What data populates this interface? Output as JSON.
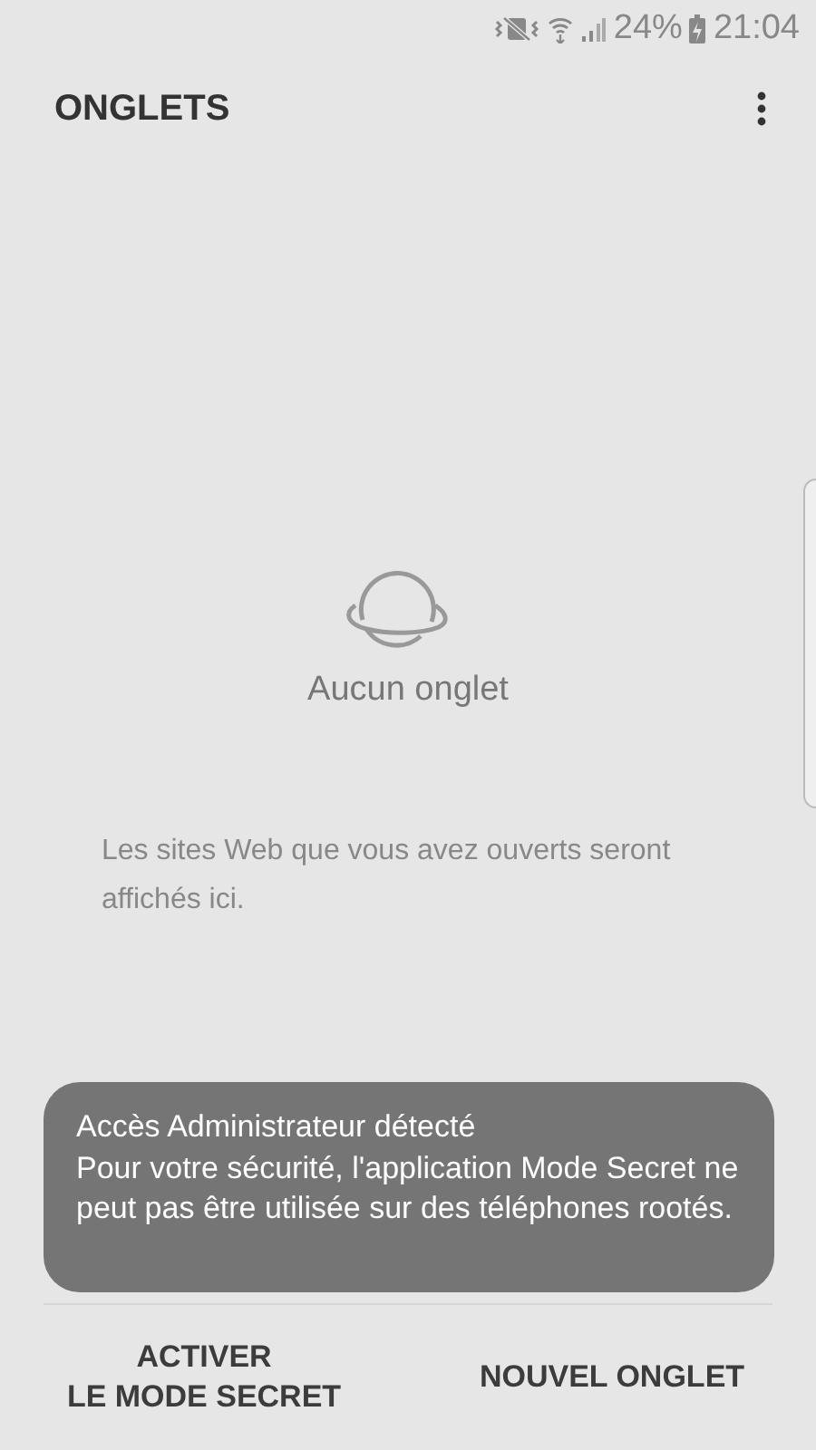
{
  "status_bar": {
    "battery": "24%",
    "time": "21:04"
  },
  "header": {
    "title": "ONGLETS"
  },
  "empty_state": {
    "title": "Aucun onglet",
    "message": "Les sites Web que vous avez ouverts seront affichés ici."
  },
  "toast": {
    "title": "Accès Administrateur détecté",
    "message": "Pour votre sécurité, l'application Mode Secret ne peut pas être utilisée sur des téléphones rootés."
  },
  "buttons": [
    {
      "label": "ACTIVER\nLE MODE SECRET"
    },
    {
      "label": "NOUVEL ONGLET"
    }
  ]
}
